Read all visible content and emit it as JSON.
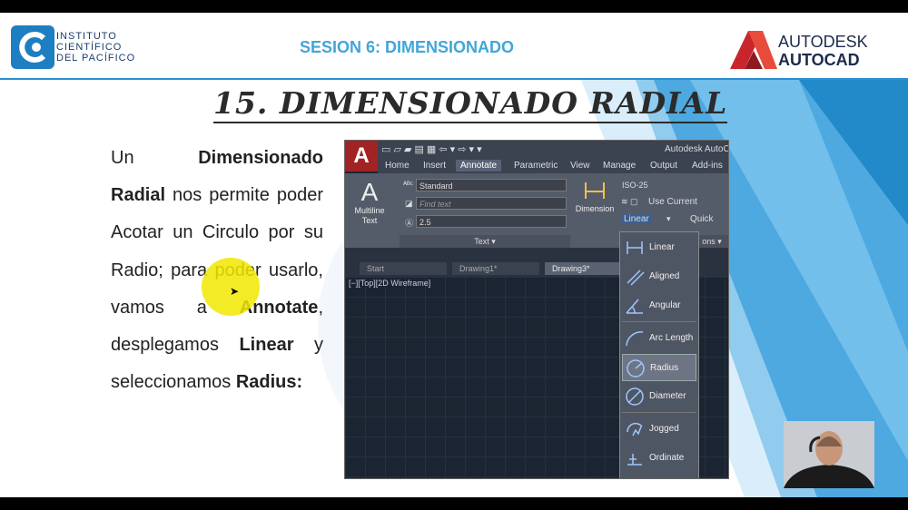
{
  "header": {
    "logo_lines": [
      "INSTITUTO",
      "CIENTÍFICO",
      "DEL PACÍFICO"
    ],
    "session_title": "SESION 6: DIMENSIONADO",
    "brand_line1": "AUTODESK",
    "brand_line2": "AUTOCAD"
  },
  "slide": {
    "title": "15. DIMENSIONADO RADIAL",
    "paragraph": [
      {
        "t": "Un ",
        "b": false
      },
      {
        "t": "Dimensionado Radial",
        "b": true
      },
      {
        "t": " nos permite poder Acotar un Circulo por su Radio; para poder usarlo, vamos a ",
        "b": false
      },
      {
        "t": "Annotate",
        "b": true
      },
      {
        "t": ", desplegamos ",
        "b": false
      },
      {
        "t": "Linear",
        "b": true
      },
      {
        "t": " y seleccionamos ",
        "b": false
      },
      {
        "t": "Radius:",
        "b": true
      }
    ]
  },
  "autocad": {
    "app_letter": "A",
    "window_title": "Autodesk AutoC",
    "qat": "▭ ▱ ▰ ▤ ▦ ⇦ ▾ ⇨ ▾ ▾",
    "ribbon_tabs": [
      "Home",
      "Insert",
      "Annotate",
      "Parametric",
      "View",
      "Manage",
      "Output",
      "Add-ins"
    ],
    "active_tab": "Annotate",
    "multiline_line1": "Multiline",
    "multiline_line2": "Text",
    "text_style": "Standard",
    "find_text_placeholder": "Find text",
    "text_height": "2.5",
    "text_panel_label": "Text ▾",
    "dimension_label": "Dimension",
    "dim_style": "ISO-25",
    "use_current": "Use Current",
    "linear_button": "Linear",
    "quick_button": "Quick",
    "dim_panel_tail": "ons ▾",
    "doc_tabs": [
      "Start",
      "Drawing1*",
      "Drawing3*"
    ],
    "active_doc_tab": "Drawing3*",
    "viewport_label": "[−][Top][2D Wireframe]",
    "dropdown_items": [
      "Linear",
      "Aligned",
      "Angular",
      "Arc Length",
      "Radius",
      "Diameter",
      "Jogged",
      "Ordinate"
    ],
    "selected_item": "Radius"
  },
  "colors": {
    "accent_blue": "#41a6d8",
    "brand_red": "#c8262c",
    "highlight_yellow": "#f1e800",
    "dark_navy": "#1d2b4c"
  }
}
